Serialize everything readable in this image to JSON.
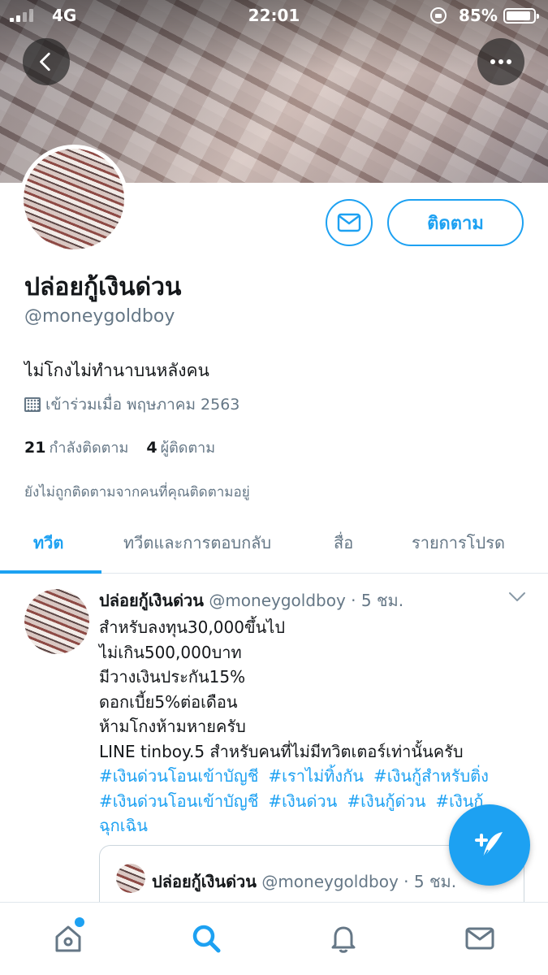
{
  "status_bar": {
    "network": "4G",
    "time": "22:01",
    "battery": "85%"
  },
  "header": {
    "back_icon": "chevron-left-icon",
    "more_icon": "more-horizontal-icon"
  },
  "profile": {
    "display_name": "ปล่อยกู้เงินด่วน",
    "handle": "@moneygoldboy",
    "follow_label": "ติดตาม",
    "bio": "ไม่โกงไม่ทำนาบนหลังคน",
    "joined": "เข้าร่วมเมื่อ พฤษภาคม 2563",
    "following_count": "21",
    "following_label": "กำลังติดตาม",
    "followers_count": "4",
    "followers_label": "ผู้ติดตาม",
    "not_followed_note": "ยังไม่ถูกติดตามจากคนที่คุณติดตามอยู่"
  },
  "tabs": [
    {
      "label": "ทวีต",
      "active": true
    },
    {
      "label": "ทวีตและการตอบกลับ",
      "active": false
    },
    {
      "label": "สื่อ",
      "active": false
    },
    {
      "label": "รายการโปรด",
      "active": false
    }
  ],
  "tweet": {
    "name": "ปล่อยกู้เงินด่วน",
    "meta": "@moneygoldboy · 5 ชม.",
    "lines": [
      "สำหรับลงทุน30,000ขึ้นไป",
      "ไม่เกิน500,000บาท",
      "มีวางเงินประกัน15%",
      "ดอกเบี้ย5%ต่อเดือน",
      "ห้ามโกงห้ามหายครับ",
      "LINE tinboy.5 สำหรับคนที่ไม่มีทวิตเตอร์เท่านั้นครับ"
    ],
    "hashtags_row1": [
      "#เงินด่วนโอนเข้าบัญชี",
      "#เราไม่ทิ้งกัน",
      "#เงินกู้สำหรับติ่ง"
    ],
    "hashtags_row2": [
      "#เงินด่วนโอนเข้าบัญชี",
      "#เงินด่วน",
      "#เงินกู้ด่วน",
      "#เงินกู้"
    ],
    "hashtags_row3": "ฉุกเฉิน",
    "quote": {
      "name": "ปล่อยกู้เงินด่วน",
      "meta": "@moneygoldboy · 5 ชม."
    }
  },
  "colors": {
    "accent": "#1da1f2",
    "text": "#14171a",
    "secondary": "#657786"
  }
}
